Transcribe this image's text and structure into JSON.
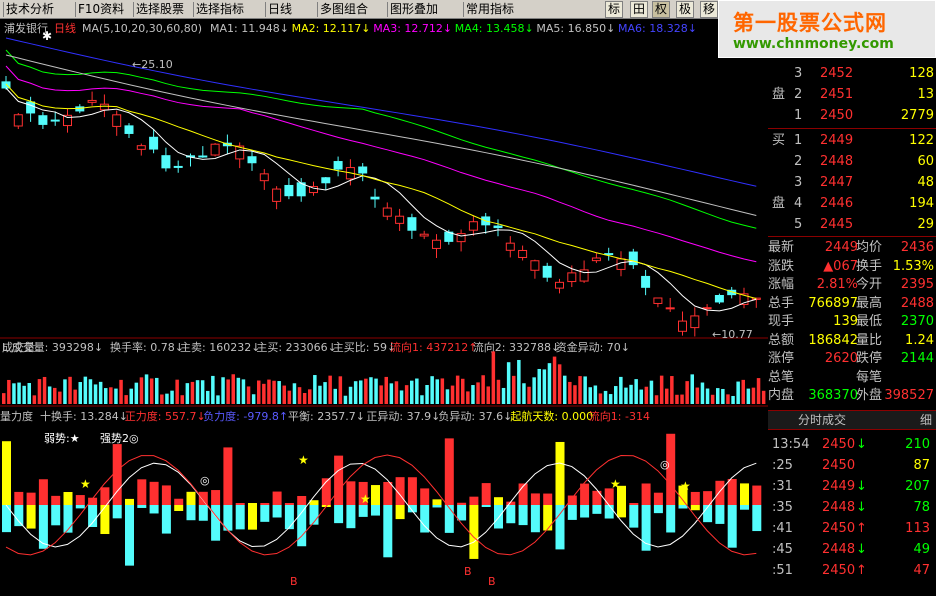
{
  "toolbar": {
    "items": [
      "技术分析",
      "F10资料",
      "选择股票",
      "选择指标",
      "日线",
      "多图组合",
      "图形叠加",
      "常用指标"
    ],
    "toggles": [
      "标",
      "田",
      "权",
      "极",
      "移"
    ]
  },
  "banner": {
    "title": "第一股票公式网",
    "url": "www.chnmoney.com"
  },
  "price_panel": {
    "stock": "浦发银行",
    "period": "日线",
    "ma_params": "MA(5,10,20,30,60,80)",
    "ma_labels": [
      {
        "name": "MA1",
        "value": "11.948↓",
        "color": "#c0c0c0"
      },
      {
        "name": "MA2",
        "value": "12.117↓",
        "color": "#ffff00"
      },
      {
        "name": "MA3",
        "value": "12.712↓",
        "color": "#ff00ff"
      },
      {
        "name": "MA4",
        "value": "13.458↓",
        "color": "#00ff00"
      },
      {
        "name": "MA5",
        "value": "16.850↓",
        "color": "#c0c0c0"
      },
      {
        "name": "MA6",
        "value": "18.328↓",
        "color": "#4444ff"
      }
    ],
    "high_label": "25.10",
    "low_label": "10.77"
  },
  "volume_panel": {
    "title": "成交量:",
    "items": [
      {
        "k": "成交量",
        "v": "393298↓",
        "c": "#c0c0c0"
      },
      {
        "k": "换手率",
        "v": "0.78↓",
        "c": "#c0c0c0"
      },
      {
        "k": "主卖",
        "v": "160232↓",
        "c": "#c0c0c0"
      },
      {
        "k": "主买",
        "v": "233066↓",
        "c": "#c0c0c0"
      },
      {
        "k": "主买比",
        "v": "59↓",
        "c": "#c0c0c0"
      },
      {
        "k": "流向1",
        "v": "437212↑",
        "c": "#ff3030"
      },
      {
        "k": "流向2",
        "v": "332788↓",
        "c": "#c0c0c0"
      },
      {
        "k": "资金异动",
        "v": "70↓",
        "c": "#c0c0c0"
      }
    ]
  },
  "force_panel": {
    "name": "量力度",
    "items": [
      {
        "k": "十换手",
        "v": "13.284↓",
        "c": "#c0c0c0"
      },
      {
        "k": "正力度",
        "v": "557.7↓",
        "c": "#ff3030"
      },
      {
        "k": "负力度",
        "v": "-979.8↑",
        "c": "#5a5aff"
      },
      {
        "k": "平衡",
        "v": "2357.7↓",
        "c": "#c0c0c0"
      },
      {
        "k": "正异动",
        "v": "37.9↓",
        "c": "#c0c0c0"
      },
      {
        "k": "负异动",
        "v": "37.6↓",
        "c": "#c0c0c0"
      },
      {
        "k": "起航天数",
        "v": "0.000",
        "c": "#ffff00"
      },
      {
        "k": "流向1",
        "v": "-314",
        "c": "#ff3030"
      }
    ],
    "legend1": "弱势:★",
    "legend2": "强势2◎",
    "marker": "B"
  },
  "quote": {
    "sell": [
      {
        "label": "",
        "n": "3",
        "price": "2452",
        "vol": "128"
      },
      {
        "label": "盘",
        "n": "2",
        "price": "2451",
        "vol": "13"
      },
      {
        "label": "",
        "n": "1",
        "price": "2450",
        "vol": "2779"
      }
    ],
    "buy": [
      {
        "label": "买",
        "n": "1",
        "price": "2449",
        "vol": "122"
      },
      {
        "label": "",
        "n": "2",
        "price": "2448",
        "vol": "60"
      },
      {
        "label": "",
        "n": "3",
        "price": "2447",
        "vol": "48"
      },
      {
        "label": "盘",
        "n": "4",
        "price": "2446",
        "vol": "194"
      },
      {
        "label": "",
        "n": "5",
        "price": "2445",
        "vol": "29"
      }
    ],
    "stats": [
      {
        "k1": "最新",
        "v1": "2449",
        "c1": "#ff3030",
        "k2": "均价",
        "v2": "2436",
        "c2": "#ff3030"
      },
      {
        "k1": "涨跌",
        "v1": "▲067",
        "c1": "#ff3030",
        "k2": "换手",
        "v2": "1.53%",
        "c2": "#ffff00"
      },
      {
        "k1": "涨幅",
        "v1": "2.81%",
        "c1": "#ff3030",
        "k2": "今开",
        "v2": "2395",
        "c2": "#ff3030"
      },
      {
        "k1": "总手",
        "v1": "766897",
        "c1": "#ffff00",
        "k2": "最高",
        "v2": "2488",
        "c2": "#ff3030"
      },
      {
        "k1": "现手",
        "v1": "139",
        "c1": "#ffff00",
        "k2": "最低",
        "v2": "2370",
        "c2": "#00ff00"
      },
      {
        "k1": "总额",
        "v1": "186842",
        "c1": "#ffff00",
        "k2": "量比",
        "v2": "1.24",
        "c2": "#ffff00"
      },
      {
        "k1": "涨停",
        "v1": "2620",
        "c1": "#ff3030",
        "k2": "跌停",
        "v2": "2144",
        "c2": "#00ff00"
      },
      {
        "k1": "总笔",
        "v1": "",
        "c1": "#c0c0c0",
        "k2": "每笔",
        "v2": "",
        "c2": "#c0c0c0"
      },
      {
        "k1": "内盘",
        "v1": "368370",
        "c1": "#00ff00",
        "k2": "外盘",
        "v2": "398527",
        "c2": "#ff3030"
      }
    ],
    "tab": "分时成交",
    "tab2": "细",
    "ticks": [
      {
        "t": "13:54",
        "p": "2450",
        "a": "↓",
        "v": "210",
        "vc": "#00ff00"
      },
      {
        "t": ":25",
        "p": "2450",
        "a": "",
        "v": "87",
        "vc": "#ffff00"
      },
      {
        "t": ":31",
        "p": "2449",
        "a": "↓",
        "v": "207",
        "vc": "#00ff00"
      },
      {
        "t": ":35",
        "p": "2448",
        "a": "↓",
        "v": "78",
        "vc": "#00ff00"
      },
      {
        "t": ":41",
        "p": "2450",
        "a": "↑",
        "v": "113",
        "vc": "#ff3030"
      },
      {
        "t": ":45",
        "p": "2448",
        "a": "↓",
        "v": "49",
        "vc": "#00ff00"
      },
      {
        "t": ":51",
        "p": "2450",
        "a": "↑",
        "v": "47",
        "vc": "#ff3030"
      }
    ]
  }
}
